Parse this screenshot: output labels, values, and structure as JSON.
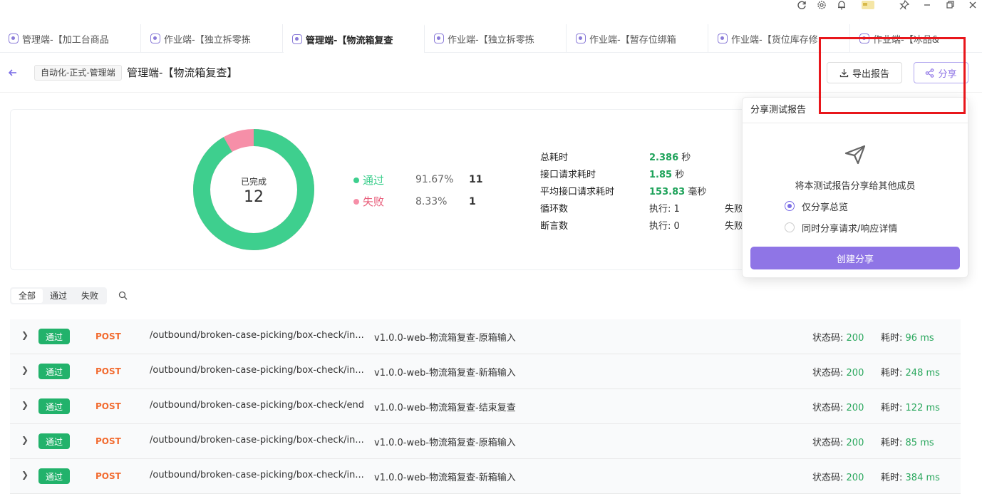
{
  "tabs": [
    {
      "label": "管理端-【加工台商品"
    },
    {
      "label": "作业端-【独立拆零拣"
    },
    {
      "label": "管理端-【物流箱复查"
    },
    {
      "label": "作业端-【独立拆零拣"
    },
    {
      "label": "作业端-【暂存位绑箱"
    },
    {
      "label": "作业端-【货位库存修"
    },
    {
      "label": "作业端-【冰品&"
    }
  ],
  "header": {
    "env_tag": "自动化-正式-管理端",
    "title": "管理端-【物流箱复查】",
    "export_label": "导出报告",
    "share_label": "分享"
  },
  "summary": {
    "donut_label": "已完成",
    "donut_total": "12",
    "pass_label": "通过",
    "pass_pct": "91.67%",
    "pass_count": "11",
    "fail_label": "失败",
    "fail_pct": "8.33%",
    "fail_count": "1",
    "pass_fraction": 0.9167,
    "stats": {
      "total_time_label": "总耗时",
      "total_time_value": "2.386",
      "total_time_unit": "秒",
      "req_time_label": "接口请求耗时",
      "req_time_value": "1.85",
      "req_time_unit": "秒",
      "avg_time_label": "平均接口请求耗时",
      "avg_time_value": "153.83",
      "avg_time_unit": "毫秒",
      "loop_label": "循环数",
      "loop_exec": "执行: 1",
      "loop_fail": "失败",
      "assert_label": "断言数",
      "assert_exec": "执行: 0",
      "assert_fail": "失败"
    }
  },
  "filter": {
    "all": "全部",
    "pass": "通过",
    "fail": "失败"
  },
  "rows": [
    {
      "status": "通过",
      "method": "POST",
      "path": "/outbound/broken-case-picking/box-check/in...",
      "name": "v1.0.0-web-物流箱复查-原箱输入",
      "code_label": "状态码:",
      "code": "200",
      "time_label": "耗时:",
      "time": "96 ms"
    },
    {
      "status": "通过",
      "method": "POST",
      "path": "/outbound/broken-case-picking/box-check/in...",
      "name": "v1.0.0-web-物流箱复查-新箱输入",
      "code_label": "状态码:",
      "code": "200",
      "time_label": "耗时:",
      "time": "248 ms"
    },
    {
      "status": "通过",
      "method": "POST",
      "path": "/outbound/broken-case-picking/box-check/end",
      "name": "v1.0.0-web-物流箱复查-结束复查",
      "code_label": "状态码:",
      "code": "200",
      "time_label": "耗时:",
      "time": "122 ms"
    },
    {
      "status": "通过",
      "method": "POST",
      "path": "/outbound/broken-case-picking/box-check/in...",
      "name": "v1.0.0-web-物流箱复查-原箱输入",
      "code_label": "状态码:",
      "code": "200",
      "time_label": "耗时:",
      "time": "85 ms"
    },
    {
      "status": "通过",
      "method": "POST",
      "path": "/outbound/broken-case-picking/box-check/in...",
      "name": "v1.0.0-web-物流箱复查-新箱输入",
      "code_label": "状态码:",
      "code": "200",
      "time_label": "耗时:",
      "time": "384 ms"
    }
  ],
  "share_popover": {
    "title": "分享测试报告",
    "desc": "将本测试报告分享给其他成员",
    "option1": "仅分享总览",
    "option2": "同时分享请求/响应详情",
    "create_label": "创建分享"
  },
  "colors": {
    "pass": "#3ecf8e",
    "fail": "#f68fa8",
    "accent": "#8f75e6",
    "highlight": "#e8161b"
  }
}
